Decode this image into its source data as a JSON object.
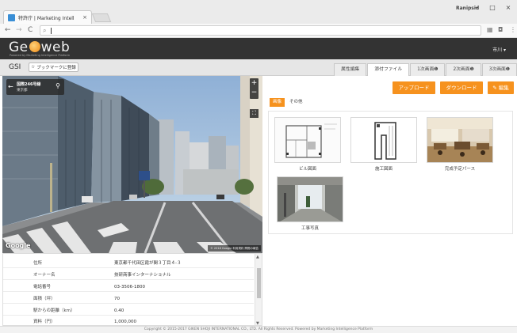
{
  "browser": {
    "tab_title": "特許庁 | Marketing Intell",
    "tab_close": "×",
    "user": "Ranipsid",
    "window": {
      "minimize": "–",
      "maximize": "□",
      "close": "×"
    },
    "nav": {
      "back": "←",
      "forward": "→",
      "reload": "C",
      "search_glyph": "⌕"
    },
    "address_value": "",
    "toolbar_icons": [
      "grid-icon",
      "camera-icon",
      "menu-icon"
    ]
  },
  "app": {
    "logo_left": "Ge",
    "logo_right": "web",
    "tagline": "Powered by Marketing Intelligence Platform",
    "city": "市川 ▾",
    "section_label": "GSI",
    "bookmark_button": "ブックマークに登録",
    "tabs": [
      "属性編集",
      "添付ファイル",
      "1次画面❶",
      "2次画面❶",
      "3次画面❶"
    ],
    "active_tab": 1,
    "accent_color": "#f6921e"
  },
  "streetview": {
    "address_line1": "国際246号線",
    "address_line2": "東京都",
    "zoom_in": "+",
    "zoom_out": "−",
    "fullscreen": "⛶",
    "google_label": "Google",
    "copyright": "© 2018 Google  利用規約  問題の報告"
  },
  "property_info": {
    "rows": [
      {
        "key": "住所",
        "value": "東京都千代田区霞が関３丁目４-３"
      },
      {
        "key": "オーナー名",
        "value": "技研商事インターナショナル"
      },
      {
        "key": "電話番号",
        "value": "03-3506-1800"
      },
      {
        "key": "面積（坪）",
        "value": "70"
      },
      {
        "key": "駅からの距離（km）",
        "value": "0.40"
      },
      {
        "key": "資料（円）",
        "value": "1,000,000"
      }
    ]
  },
  "attachments": {
    "buttons": {
      "upload": "アップロード",
      "download": "ダウンロード",
      "edit": "✎ 編集"
    },
    "subtabs": [
      "画像",
      "その他"
    ],
    "active_subtab": 0,
    "files": [
      {
        "caption": "ビル図面",
        "kind": "floorplan-image"
      },
      {
        "caption": "施工図面",
        "kind": "blueprint-image"
      },
      {
        "caption": "完成予定パース",
        "kind": "interior-photo"
      },
      {
        "caption": "工事写真",
        "kind": "construction-photo"
      }
    ]
  },
  "footer": {
    "text": "Copyright © 2015-2017 GIKEN SHOJI INTERNATIONAL CO., LTD. All Rights Reserved.  Powered by Marketing Intelligence Platform"
  }
}
